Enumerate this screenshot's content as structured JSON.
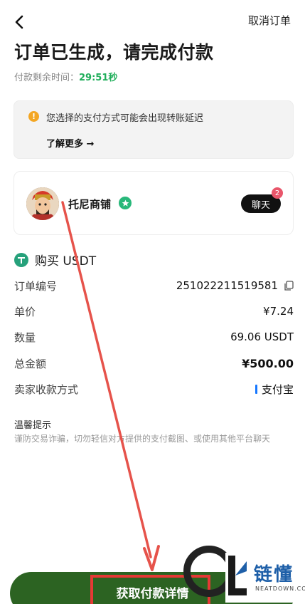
{
  "header": {
    "cancel_label": "取消订单",
    "title": "订单已生成，请完成付款"
  },
  "timer": {
    "label": "付款剩余时间：",
    "value": "29:51秒"
  },
  "warning": {
    "text": "您选择的支付方式可能会出现转账延迟",
    "link": "了解更多 →"
  },
  "seller": {
    "name": "托尼商铺",
    "chat_label": "聊天",
    "unread": "2"
  },
  "order": {
    "title": "购买 USDT",
    "rows": [
      {
        "label": "订单编号",
        "value": "251022211519581"
      },
      {
        "label": "单价",
        "value": "¥7.24"
      },
      {
        "label": "数量",
        "value": "69.06 USDT"
      },
      {
        "label": "总金额",
        "value": "¥500.00"
      },
      {
        "label": "卖家收款方式",
        "value": "支付宝"
      }
    ]
  },
  "tips": {
    "title": "温馨提示",
    "body": "谨防交易诈骗，切勿轻信对方提供的支付截图、或使用其他平台聊天"
  },
  "cta": {
    "label": "获取付款详情"
  },
  "watermark": {
    "brand": "链懂",
    "site": "NEATDOWN.COM"
  },
  "colors": {
    "accent_green": "#1fae5a",
    "cta": "#2c6322",
    "annotation_red": "#e53935"
  }
}
